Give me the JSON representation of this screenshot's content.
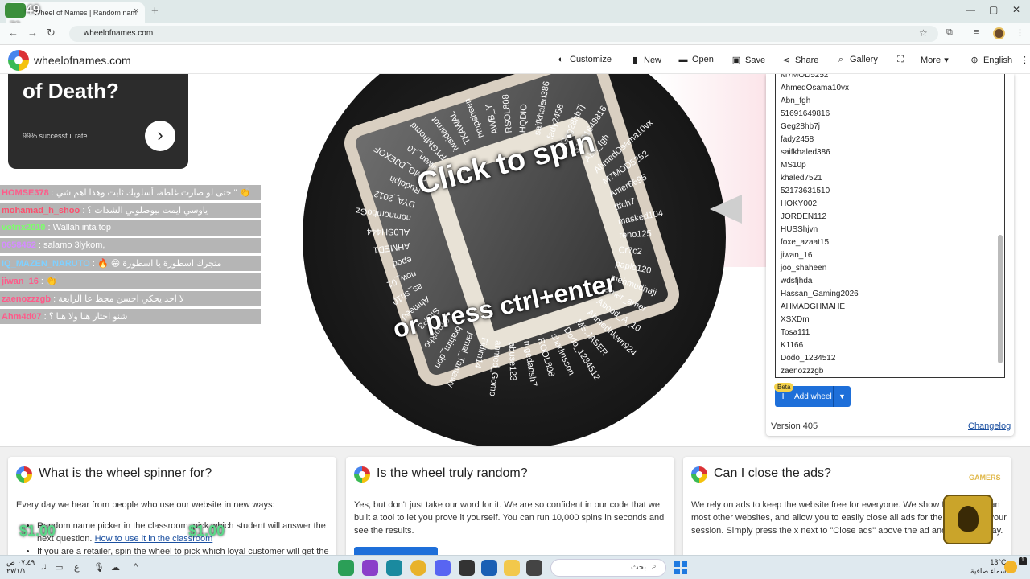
{
  "browser": {
    "tab_title": "Wheel of Names | Random nam",
    "tab_close": "×",
    "new_tab": "+",
    "badge_count": "49",
    "badge_sub": "72",
    "url": "wheelofnames.com",
    "window_controls": [
      "—",
      "▢",
      "✕"
    ]
  },
  "site": {
    "name": "wheelofnames.com",
    "menu": [
      {
        "label": "Customize",
        "icon": "palette-icon",
        "glyph": "🎨"
      },
      {
        "label": "New",
        "icon": "file-icon",
        "glyph": "▮"
      },
      {
        "label": "Open",
        "icon": "folder-icon",
        "glyph": "▬"
      },
      {
        "label": "Save",
        "icon": "save-icon",
        "glyph": "▣"
      },
      {
        "label": "Share",
        "icon": "share-icon",
        "glyph": "⋖"
      },
      {
        "label": "Gallery",
        "icon": "search-icon",
        "glyph": "⌕"
      },
      {
        "label": "",
        "icon": "fullscreen-icon",
        "glyph": "⛶"
      },
      {
        "label": "More",
        "icon": "chevron-down-icon",
        "glyph": "▾"
      },
      {
        "label": "English",
        "icon": "globe-icon",
        "glyph": "⊕"
      }
    ]
  },
  "promo": {
    "title": "of Death?",
    "subtitle": "99% successful rate",
    "next": "›"
  },
  "chat": [
    {
      "user": "HOMSE378",
      "text": " : حتى لو صارت غلطة، أسلوبك ثابت وهذا اهم شي \" 👏"
    },
    {
      "user": "mohamad_h_shoo",
      "text": " : ياوسي ايمت بيوصلوني الشدات ؟"
    },
    {
      "user": "votrix2010",
      "text": " : Wallah inta top"
    },
    {
      "user": "0658462",
      "text": " : salamo 3lykom,"
    },
    {
      "user": "IQ_MAZEN_NARUTO",
      "text": " : 🔥 😁 متجرك اسطورة يا اسطورة"
    },
    {
      "user": "jiwan_16",
      "text": " : 👏"
    },
    {
      "user": "zaenozzzgb",
      "text": " : لا احد يحكي احسن مجظ عا الرابعة"
    },
    {
      "user": "Ahm4d07",
      "text": " : شنو اختار هنا ولا هنا ؟"
    }
  ],
  "wheel": {
    "cta_top": "Click to spin",
    "cta_bottom": "or press ctrl+enter",
    "slice_names": [
      "saifkhaled386",
      "fady2458",
      "Geg28hb7j",
      "51691649816",
      "Abn_fgh",
      "AhmedOsama10vx",
      "M7MOD5252",
      "Amer6695",
      "tffch7",
      "masked104",
      "reno125",
      "Cr7c2",
      "paplo120",
      "mehmudhaji",
      "amer_amer",
      "Abood_A_10",
      "Ahmedhkwn924",
      "MS.JASER",
      "Dodo_1234512",
      "shadinsson",
      "ROOL808",
      "mgedabsh7",
      "abuse123",
      "ahmed_Gomo",
      "Fidim14",
      "jamal_Tantawy",
      "brahim_don",
      "Omorkho",
      "SIOP3",
      "Ahmeed",
      "as_sh10",
      "now_01",
      "epod",
      "AHMED1",
      "AL0SH444",
      "nomnomboGz",
      "DYA_2012",
      "Rudolph",
      "OMG_DJEXOF",
      "iiwan_10",
      "RTGMhomd",
      "iwaidamot",
      "TKAWAL",
      "hmpsheen",
      "AWB_Y",
      "RSOL808",
      "HQDIO"
    ]
  },
  "entries": {
    "names": [
      "M7MOD5252",
      "AhmedOsama10vx",
      "Abn_fgh",
      "51691649816",
      "Geg28hb7j",
      "fady2458",
      "saifkhaled386",
      "MS10p",
      "khaled7521",
      "52173631510",
      "HOKY002",
      "JORDEN112",
      "HUSShjvn",
      "foxe_azaat15",
      "jiwan_16",
      "joo_shaheen",
      "wdsfjhda",
      "Hassan_Gaming2026",
      "AHMADGHMAHE",
      "XSXDm",
      "Tosa111",
      "K1166",
      "Dodo_1234512",
      "zaenozzzgb"
    ],
    "beta": "Beta",
    "add_wheel": "Add wheel",
    "version": "Version 405",
    "changelog": "Changelog"
  },
  "cards": [
    {
      "title": "What is the wheel spinner for?",
      "intro": "Every day we hear from people who use our website in new ways:",
      "bullet1_text": "Random name picker in the classroom: pick which student will answer the next question. ",
      "bullet1_link": "How to use it in the classroom",
      "bullet2_text": "If you are a retailer, spin the wheel to pick which loyal customer will get the"
    },
    {
      "title": "Is the wheel truly random?",
      "body": "Yes, but don't just take our word for it. We are so confident in our code that we built a tool to let you prove it yourself. You can run 10,000 spins in seconds and see the results."
    },
    {
      "title": "Can I close the ads?",
      "body": "We rely on ads to keep the website free for everyone. We show fewer ads than most other websites, and allow you to easily close all ads for the duration of your session. Simply press the x next to \"Close ads\" above the ad and they go away."
    }
  ],
  "overlay": {
    "money_left": "$1.00",
    "money_right": "$1.00",
    "gamers": "GAMERS"
  },
  "taskbar": {
    "time": "٠٧:٤٩ ص",
    "date": "٢٧/١/١",
    "search_placeholder": "بحث",
    "weather_temp": "13°C",
    "weather_desc": "سماء صافية",
    "notif": "1",
    "lang": "ع"
  }
}
